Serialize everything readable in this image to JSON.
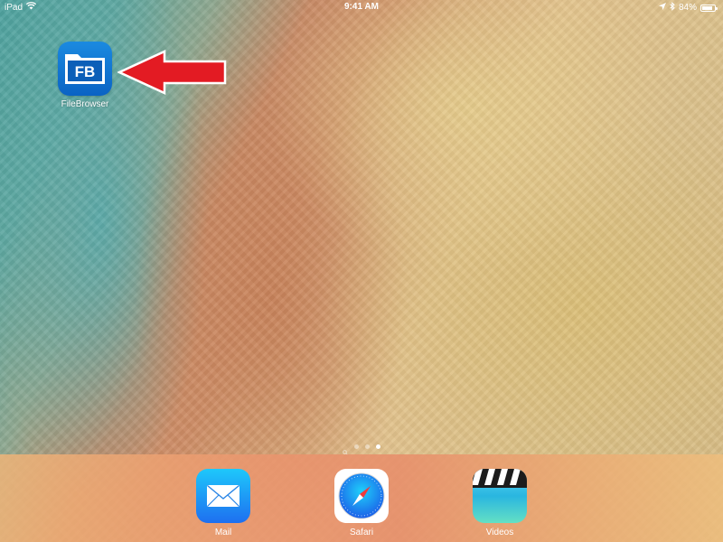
{
  "status_bar": {
    "device": "iPad",
    "time": "9:41 AM",
    "battery_percent": "84%",
    "battery_level": 0.84,
    "icons": [
      "wifi-icon",
      "location-arrow-icon",
      "bluetooth-icon",
      "battery-icon"
    ]
  },
  "home": {
    "apps": [
      {
        "label": "FileBrowser",
        "icon_text": "FB",
        "icon": "filebrowser-icon"
      }
    ],
    "pages": {
      "count": 3,
      "current": 3,
      "has_spotlight": true
    }
  },
  "annotation": {
    "type": "arrow",
    "color": "#e31b23",
    "points_to": "FileBrowser"
  },
  "dock": {
    "apps": [
      {
        "label": "Mail",
        "icon": "mail-icon"
      },
      {
        "label": "Safari",
        "icon": "safari-icon"
      },
      {
        "label": "Videos",
        "icon": "videos-icon"
      }
    ]
  },
  "colors": {
    "accent_blue": "#0a63c4",
    "arrow_red": "#e31b23"
  }
}
